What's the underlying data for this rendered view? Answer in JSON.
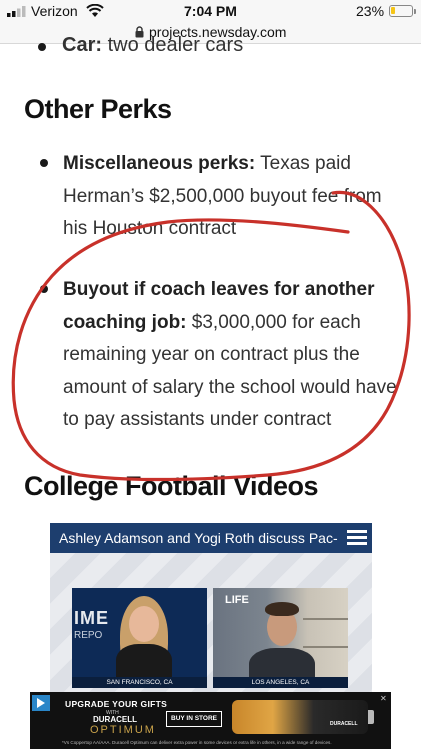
{
  "status_bar": {
    "carrier": "Verizon",
    "time": "7:04 PM",
    "battery_percent": "23%",
    "battery_level": 0.23,
    "icons": [
      "signal-bars-icon",
      "wifi-icon",
      "battery-icon"
    ]
  },
  "browser": {
    "url": "projects.newsday.com",
    "icons": [
      "lock-icon"
    ]
  },
  "article": {
    "previous_item_bold": "Car:",
    "previous_item_text": "two dealer cars",
    "other_perks_heading": "Other Perks",
    "perks": [
      {
        "label": "Miscellaneous perks:",
        "text": "Texas paid Herman’s $2,500,000 buyout fee from his Houston contract"
      },
      {
        "label": "Buyout if coach leaves for another coaching job:",
        "text": "$3,000,000 for each remaining year on contract plus the amount of salary the school would have to pay assistants under contract"
      }
    ],
    "videos_heading": "College Football Videos"
  },
  "video": {
    "title": "Ashley Adamson and Yogi Roth discuss Pac-",
    "left_location": "SAN FRANCISCO, CA",
    "right_location": "LOS ANGELES, CA",
    "left_backdrop_text_1": "IME",
    "left_backdrop_text_2": "REPO",
    "right_backdrop_text": "LIFE",
    "icons": [
      "hamburger-menu-icon"
    ]
  },
  "ad": {
    "headline": "UPGRADE YOUR GIFTS",
    "with": "WITH",
    "brand": "DURACELL",
    "product": "OPTIMUM",
    "cta": "BUY IN STORE",
    "battery_brand": "DURACELL",
    "fine_print": "*Vs Coppertop AA/AAA. Duracell Optimum can deliver extra power in some devices or extra life in others, in a wide range of devices.",
    "icons": [
      "ad-choices-icon",
      "close-icon"
    ]
  },
  "colors": {
    "annotation": "#c8312a",
    "video_title_bar": "#1d3e6e",
    "battery": "#f5c518",
    "text": "#333333",
    "heading": "#111111"
  }
}
